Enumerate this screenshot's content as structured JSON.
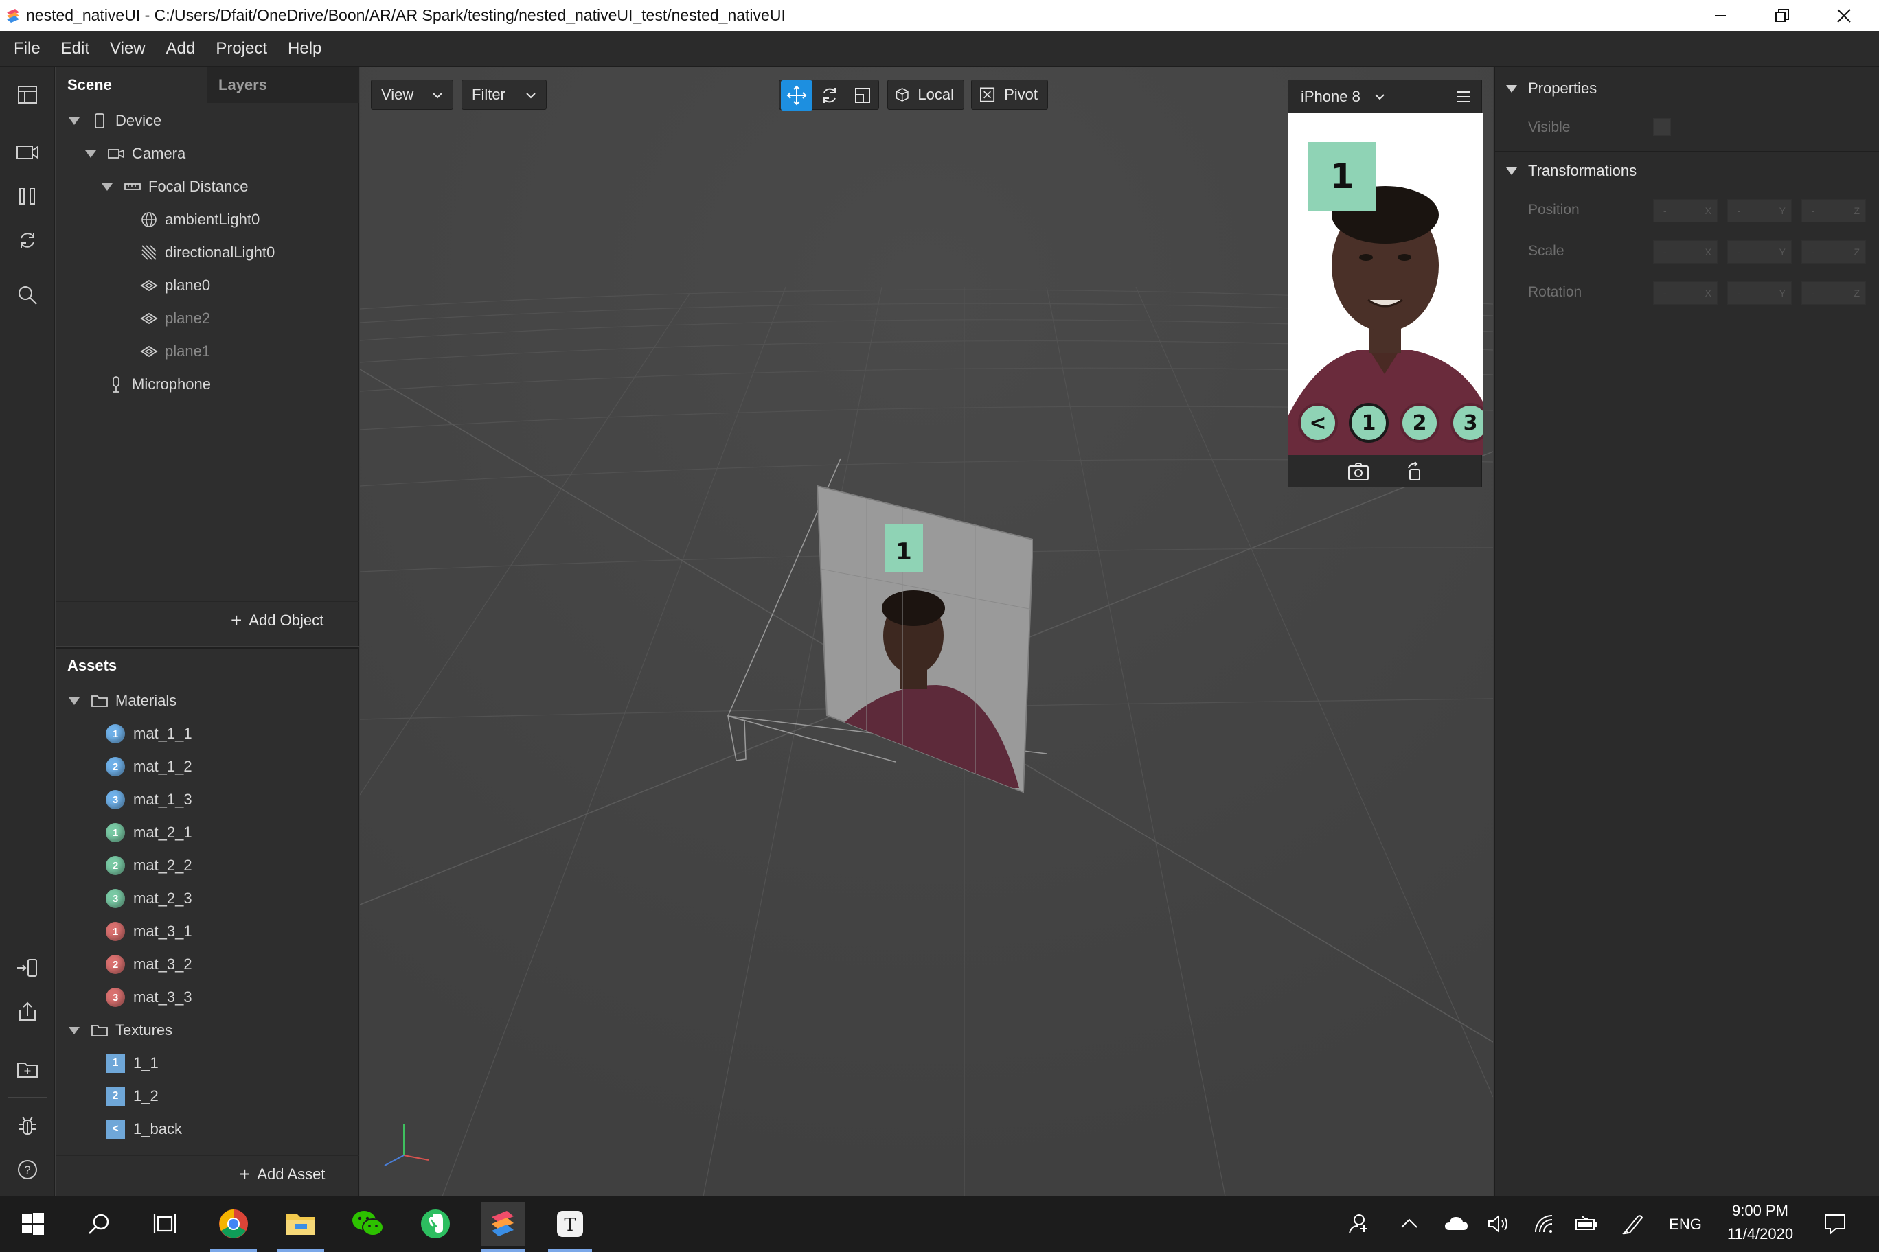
{
  "window": {
    "title": "nested_nativeUI - C:/Users/Dfait/OneDrive/Boon/AR/AR Spark/testing/nested_nativeUI_test/nested_nativeUI"
  },
  "menu": [
    "File",
    "Edit",
    "View",
    "Add",
    "Project",
    "Help"
  ],
  "scene_panel": {
    "tabs": [
      "Scene",
      "Layers"
    ],
    "tree": [
      {
        "label": "Device",
        "icon": "phone-icon",
        "dim": false
      },
      {
        "label": "Camera",
        "icon": "camera-icon",
        "dim": false
      },
      {
        "label": "Focal Distance",
        "icon": "focal-distance-icon",
        "dim": false
      },
      {
        "label": "ambientLight0",
        "icon": "ambient-light-icon",
        "dim": false
      },
      {
        "label": "directionalLight0",
        "icon": "directional-light-icon",
        "dim": false
      },
      {
        "label": "plane0",
        "icon": "plane-icon",
        "dim": false
      },
      {
        "label": "plane2",
        "icon": "plane-icon",
        "dim": true
      },
      {
        "label": "plane1",
        "icon": "plane-icon",
        "dim": true
      },
      {
        "label": "Microphone",
        "icon": "microphone-icon",
        "dim": false
      }
    ],
    "add_object": "Add Object"
  },
  "assets_panel": {
    "title": "Assets",
    "materials_folder": "Materials",
    "materials": [
      {
        "label": "mat_1_1",
        "badge": "1",
        "color": "#6fb0e8"
      },
      {
        "label": "mat_1_2",
        "badge": "2",
        "color": "#6fb0e8"
      },
      {
        "label": "mat_1_3",
        "badge": "3",
        "color": "#6fb0e8"
      },
      {
        "label": "mat_2_1",
        "badge": "1",
        "color": "#79c9a4"
      },
      {
        "label": "mat_2_2",
        "badge": "2",
        "color": "#79c9a4"
      },
      {
        "label": "mat_2_3",
        "badge": "3",
        "color": "#79c9a4"
      },
      {
        "label": "mat_3_1",
        "badge": "1",
        "color": "#d9706f"
      },
      {
        "label": "mat_3_2",
        "badge": "2",
        "color": "#d9706f"
      },
      {
        "label": "mat_3_3",
        "badge": "3",
        "color": "#d9706f"
      }
    ],
    "textures_folder": "Textures",
    "textures": [
      {
        "label": "1_1",
        "badge": "1"
      },
      {
        "label": "1_2",
        "badge": "2"
      },
      {
        "label": "1_back",
        "badge": "<"
      }
    ],
    "add_asset": "Add Asset"
  },
  "viewport": {
    "view_label": "View",
    "filter_label": "Filter",
    "local_label": "Local",
    "pivot_label": "Pivot",
    "plane_label": "1"
  },
  "simulator": {
    "device": "iPhone 8",
    "label": "1",
    "buttons": [
      "<",
      "1",
      "2",
      "3"
    ]
  },
  "properties": {
    "section": "Properties",
    "visible_label": "Visible",
    "transform_section": "Transformations",
    "rows": [
      "Position",
      "Scale",
      "Rotation"
    ],
    "field_value": "-",
    "axes": [
      "X",
      "Y",
      "Z"
    ]
  },
  "taskbar": {
    "lang": "ENG",
    "time": "9:00 PM",
    "date": "11/4/2020"
  },
  "colors": {
    "accent": "#1d8fe0",
    "mint": "#8fd3b5"
  }
}
